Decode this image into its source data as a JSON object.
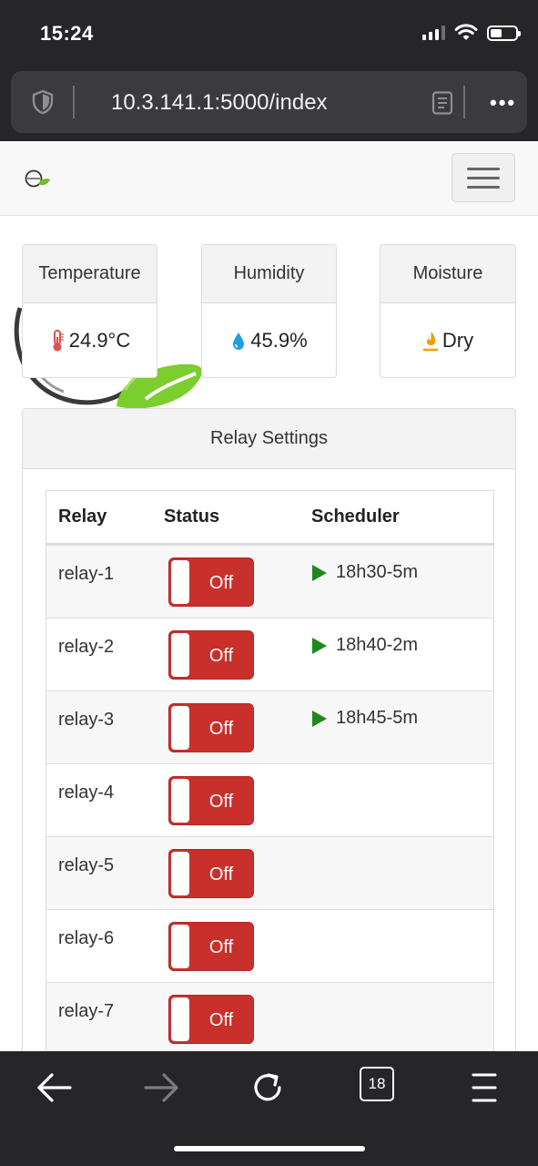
{
  "status_bar": {
    "time": "15:24"
  },
  "browser": {
    "url": "10.3.141.1:5000/index",
    "more_label": "•••",
    "tab_count": "18"
  },
  "sensors": [
    {
      "title": "Temperature",
      "value": "24.9°C",
      "icon": "thermometer-icon",
      "color": "#d9534f"
    },
    {
      "title": "Humidity",
      "value": "45.9%",
      "icon": "water-drop-icon",
      "color": "#1e9fe0"
    },
    {
      "title": "Moisture",
      "value": "Dry",
      "icon": "dry-soil-icon",
      "color": "#f0a000"
    }
  ],
  "relay_settings": {
    "title": "Relay Settings",
    "columns": [
      "Relay",
      "Status",
      "Scheduler"
    ],
    "rows": [
      {
        "name": "relay-1",
        "status": "Off",
        "schedule": "18h30-5m"
      },
      {
        "name": "relay-2",
        "status": "Off",
        "schedule": "18h40-2m"
      },
      {
        "name": "relay-3",
        "status": "Off",
        "schedule": "18h45-5m"
      },
      {
        "name": "relay-4",
        "status": "Off",
        "schedule": ""
      },
      {
        "name": "relay-5",
        "status": "Off",
        "schedule": ""
      },
      {
        "name": "relay-6",
        "status": "Off",
        "schedule": ""
      },
      {
        "name": "relay-7",
        "status": "Off",
        "schedule": ""
      }
    ]
  },
  "colors": {
    "toggle_off": "#c9302c",
    "play": "#1e8a1e",
    "chrome": "#262629"
  }
}
